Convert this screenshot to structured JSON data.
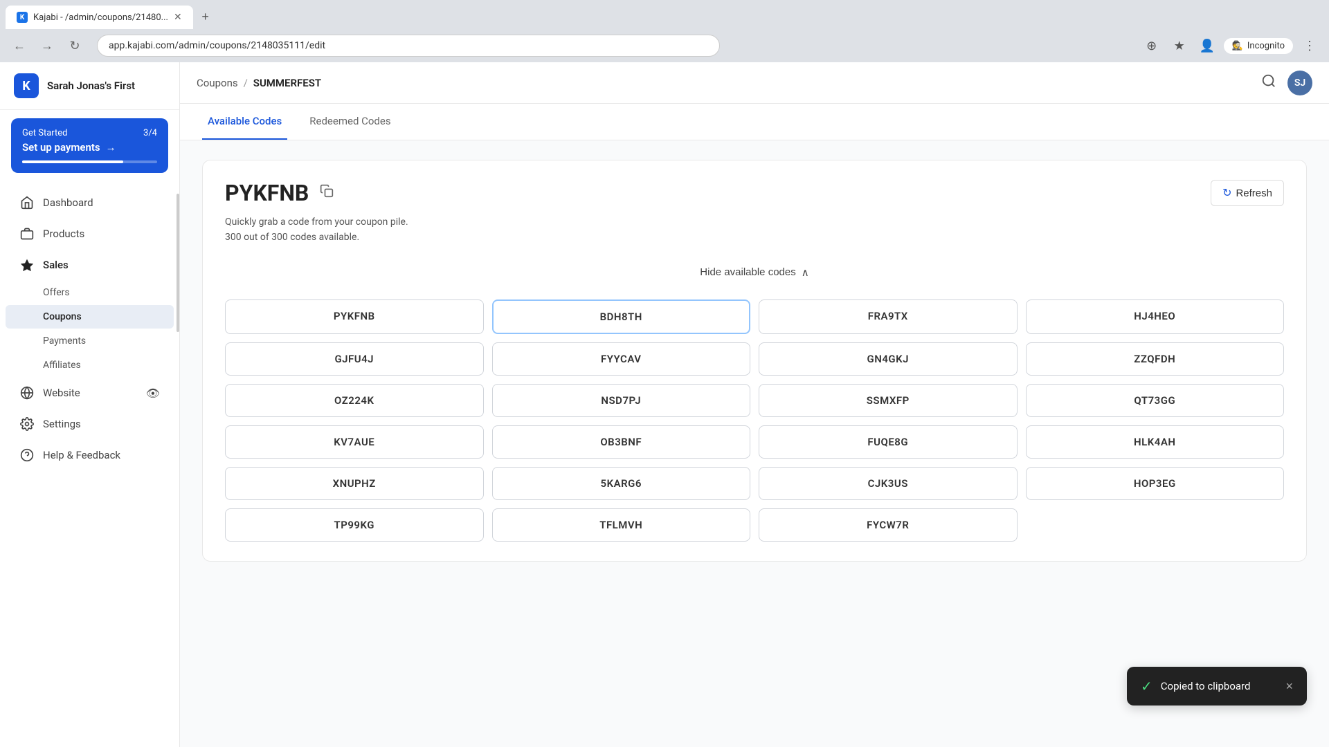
{
  "browser": {
    "tab_title": "Kajabi - /admin/coupons/21480...",
    "tab_favicon": "K",
    "url": "app.kajabi.com/admin/coupons/2148035111/edit",
    "new_tab_symbol": "+",
    "incognito_label": "Incognito"
  },
  "sidebar": {
    "logo_text": "K",
    "company_name": "Sarah Jonas's First",
    "get_started": {
      "label": "Get Started",
      "progress": "3/4",
      "title": "Set up payments",
      "arrow": "→"
    },
    "nav_items": [
      {
        "id": "dashboard",
        "label": "Dashboard",
        "icon": "🏠"
      },
      {
        "id": "products",
        "label": "Products",
        "icon": "📦"
      },
      {
        "id": "sales",
        "label": "Sales",
        "icon": "◆",
        "active": true
      },
      {
        "id": "offers",
        "label": "Offers",
        "sub": true
      },
      {
        "id": "coupons",
        "label": "Coupons",
        "sub": true,
        "active": true
      },
      {
        "id": "payments",
        "label": "Payments",
        "sub": true
      },
      {
        "id": "affiliates",
        "label": "Affiliates",
        "sub": true
      },
      {
        "id": "website",
        "label": "Website",
        "icon": "🌐"
      },
      {
        "id": "settings",
        "label": "Settings",
        "icon": "⚙️"
      },
      {
        "id": "help",
        "label": "Help & Feedback",
        "icon": "❓"
      }
    ]
  },
  "header": {
    "breadcrumb_parent": "Coupons",
    "breadcrumb_sep": "/",
    "breadcrumb_current": "SUMMERFEST",
    "avatar_initials": "SJ"
  },
  "tabs": [
    {
      "id": "available",
      "label": "Available Codes",
      "active": true
    },
    {
      "id": "redeemed",
      "label": "Redeemed Codes"
    }
  ],
  "coupon": {
    "code": "PYKFNB",
    "copy_icon": "⧉",
    "refresh_label": "Refresh",
    "description_line1": "Quickly grab a code from your coupon pile.",
    "description_line2": "300 out of 300 codes available.",
    "hide_label": "Hide available codes",
    "hide_icon": "∧",
    "codes": [
      "PYKFNB",
      "BDH8TH",
      "FRA9TX",
      "HJ4HEO",
      "GJFU4J",
      "FYYCAV",
      "GN4GKJ",
      "ZZQFDH",
      "OZ224K",
      "NSD7PJ",
      "SSMXFP",
      "QT73GG",
      "KV7AUE",
      "OB3BNF",
      "FUQE8G",
      "HLK4AH",
      "XNUPHZ",
      "5KARG6",
      "CJK3US",
      "",
      "HOP3EG",
      "TP99KG",
      "TFLMVH",
      "FYCW7R"
    ],
    "highlighted_code": "BDH8TH"
  },
  "toast": {
    "icon": "✓",
    "message": "Copied to clipboard",
    "close_icon": "×"
  }
}
